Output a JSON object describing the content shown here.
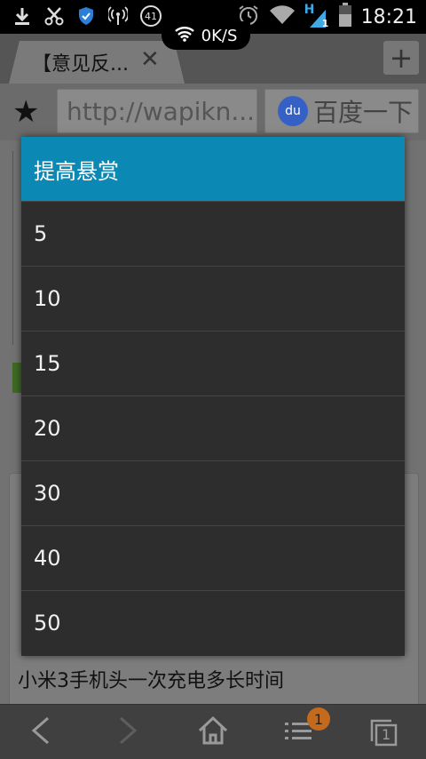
{
  "status": {
    "time": "18:21",
    "net_speed": "0K/S",
    "notif_badge": "41",
    "signal_type": "H",
    "signal_sub": "1"
  },
  "browser": {
    "tab_title": "【意见反...",
    "close_glyph": "✕",
    "new_tab_glyph": "+",
    "url": "http://wapikn...",
    "search_button": "百度一下",
    "baidu_logo_text": "du"
  },
  "page": {
    "visible_text": "小米3手机头一次充电多长时间"
  },
  "dialog": {
    "title": "提高悬赏",
    "options": [
      "5",
      "10",
      "15",
      "20",
      "30",
      "40",
      "50"
    ]
  },
  "bottom_nav": {
    "menu_badge": "1",
    "tabs_count": "1"
  },
  "colors": {
    "dialog_header": "#0c88b4",
    "dialog_bg": "#2d2d2d",
    "badge": "#c46a1d"
  },
  "icons": [
    "download-icon",
    "scissors-icon",
    "shield-icon",
    "hotspot-icon",
    "notification-icon",
    "alarm-icon",
    "wifi-icon",
    "battery-icon",
    "star-icon",
    "back-icon",
    "forward-icon",
    "home-icon",
    "menu-icon",
    "tabs-icon"
  ]
}
